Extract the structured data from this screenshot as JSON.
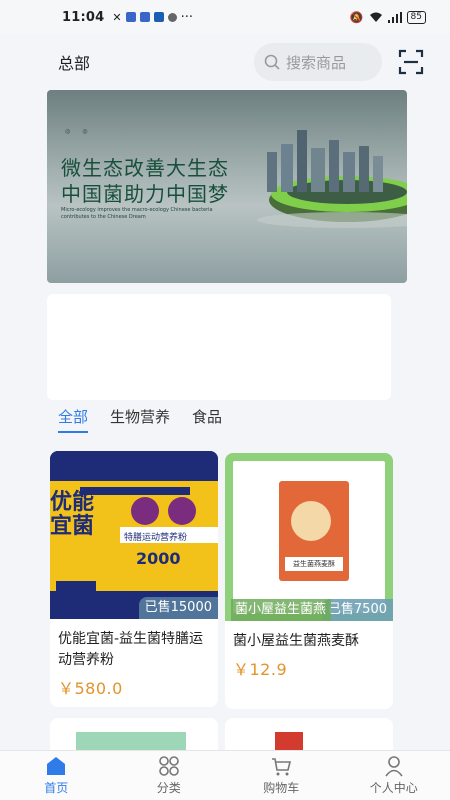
{
  "status_bar": {
    "time": "11:04",
    "battery": "85"
  },
  "header": {
    "location": "总部",
    "search_placeholder": "搜索商品"
  },
  "banner": {
    "line1": "微生态改善大生态",
    "line2": "中国菌助力中国梦",
    "sub": "Micro-ecology improves the macro-ecology Chinese bacteria contributes to the Chinese Dream"
  },
  "tabs": [
    "全部",
    "生物营养",
    "食品"
  ],
  "products": [
    {
      "name": "优能宜菌-益生菌特膳运动营养粉",
      "price": "￥580.0",
      "sold": "已售15000",
      "img_text_1": "优能宜菌",
      "img_text_2": "2000",
      "img_text_3": "特膳运动营养粉"
    },
    {
      "name": "菌小屋益生菌燕麦酥",
      "price": "￥12.9",
      "sold": "已售7500",
      "overlay": "菌小屋益生菌燕",
      "pkg_text": "益生菌燕麦酥"
    }
  ],
  "nav": [
    {
      "label": "首页",
      "icon": "home-icon"
    },
    {
      "label": "分类",
      "icon": "category-icon"
    },
    {
      "label": "购物车",
      "icon": "cart-icon"
    },
    {
      "label": "个人中心",
      "icon": "user-icon"
    }
  ],
  "colors": {
    "accent": "#2f7be8",
    "price": "#e4932b"
  }
}
